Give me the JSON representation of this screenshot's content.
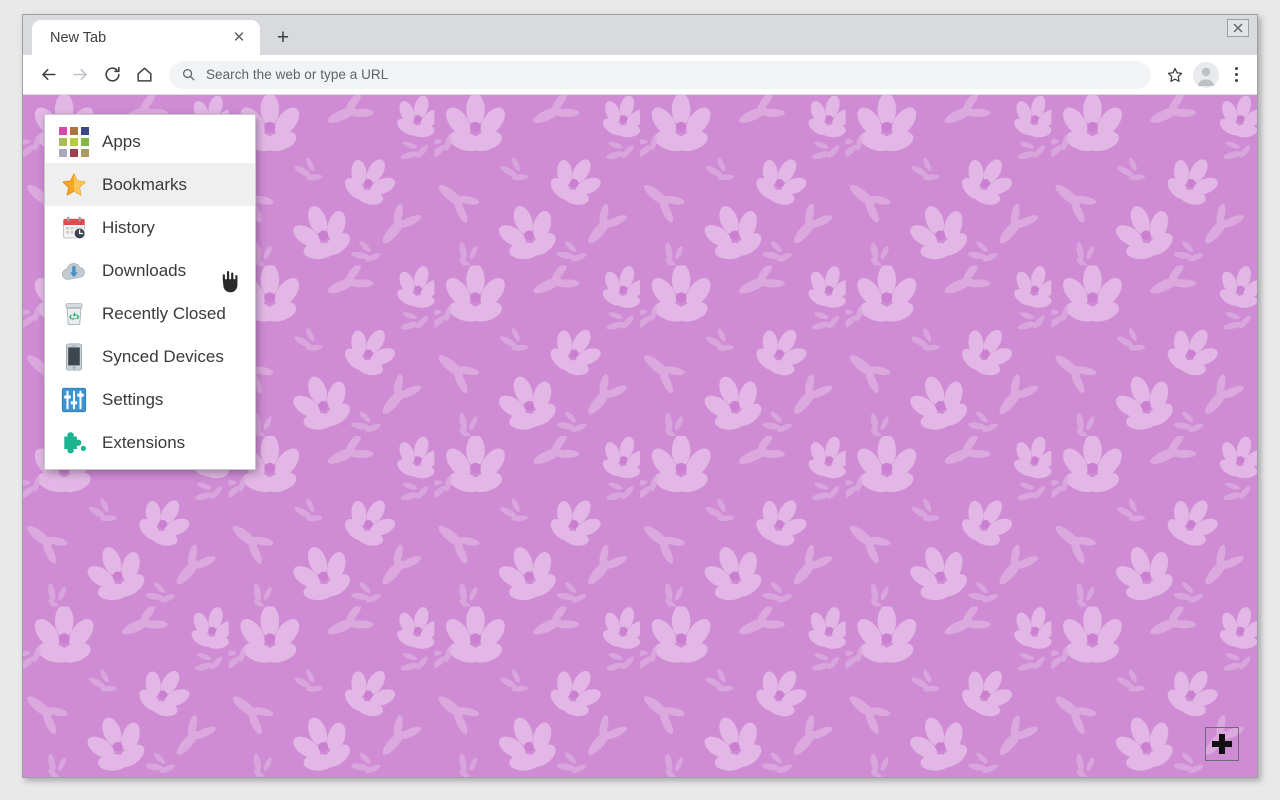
{
  "window": {
    "close_label": "✕"
  },
  "tab_strip": {
    "tabs": [
      {
        "title": "New Tab",
        "close_label": "✕",
        "active": true
      }
    ],
    "new_tab_label": "+"
  },
  "toolbar": {
    "back_label": "←",
    "forward_label": "→",
    "reload_label": "⟳",
    "home_label": "⌂",
    "bookmark_star_label": "☆",
    "profile_label": "",
    "menu_label": "⋮"
  },
  "omnibox": {
    "placeholder": "Search the web or type a URL",
    "value": "",
    "search_icon": "search-icon"
  },
  "dropdown_menu": {
    "items": [
      {
        "label": "Apps",
        "icon": "apps-grid-icon",
        "highlighted": false
      },
      {
        "label": "Bookmarks",
        "icon": "star-icon",
        "highlighted": true
      },
      {
        "label": "History",
        "icon": "calendar-clock-icon",
        "highlighted": false
      },
      {
        "label": "Downloads",
        "icon": "cloud-download-icon",
        "highlighted": false
      },
      {
        "label": "Recently Closed",
        "icon": "recycle-bin-icon",
        "highlighted": false
      },
      {
        "label": "Synced Devices",
        "icon": "smartphone-icon",
        "highlighted": false
      },
      {
        "label": "Settings",
        "icon": "sliders-icon",
        "highlighted": false
      },
      {
        "label": "Extensions",
        "icon": "puzzle-piece-icon",
        "highlighted": false
      }
    ]
  },
  "page": {
    "wallpaper_name": "pink-floral-pattern",
    "wallpaper_base_color": "#cf8cd5",
    "wallpaper_motif_color": "#e2b6e4"
  },
  "floating_button": {
    "label": "+",
    "name": "add-button"
  },
  "colors": {
    "tab_strip_bg": "#d8dadd",
    "toolbar_bg": "#ffffff",
    "omnibox_bg": "#f1f3f4",
    "menu_bg": "#ffffff",
    "menu_highlight": "#efefef",
    "desktop_bg": "#e9e9e9"
  },
  "apps_icon_colors": [
    "#d249a8",
    "#a5763a",
    "#3d4784",
    "#aab85e",
    "#b6cb3f",
    "#82b742",
    "#a8a8bc",
    "#a03d53",
    "#ab9a62"
  ]
}
